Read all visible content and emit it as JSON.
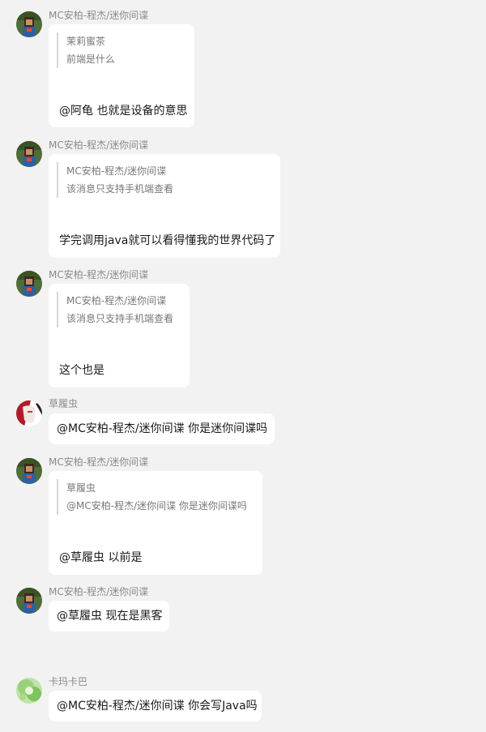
{
  "messages": [
    {
      "sender": "MC安柏-程杰/迷你间谍",
      "avatar": "mc-avatar",
      "quote": {
        "author": "茉莉蜜茶",
        "text": "前端是什么"
      },
      "text": "@阿龟 也就是设备的意思"
    },
    {
      "sender": "MC安柏-程杰/迷你间谍",
      "avatar": "mc-avatar",
      "quote": {
        "author": "MC安柏-程杰/迷你间谍",
        "text": "该消息只支持手机端查看"
      },
      "text": "学完调用java就可以看得懂我的世界代码了"
    },
    {
      "sender": "MC安柏-程杰/迷你间谍",
      "avatar": "mc-avatar",
      "quote": {
        "author": "MC安柏-程杰/迷你间谍",
        "text": "该消息只支持手机端查看"
      },
      "text": "这个也是"
    },
    {
      "sender": "草履虫",
      "avatar": "anime-avatar",
      "text": "@MC安柏-程杰/迷你间谍 你是迷你间谍吗"
    },
    {
      "sender": "MC安柏-程杰/迷你间谍",
      "avatar": "mc-avatar",
      "quote": {
        "author": "草履虫",
        "text": "@MC安柏-程杰/迷你间谍 你是迷你间谍吗"
      },
      "text": "@草履虫 以前是"
    },
    {
      "sender": "MC安柏-程杰/迷你间谍",
      "avatar": "mc-avatar",
      "text": "@草履虫 现在是黑客"
    },
    {
      "sender": "卡玛卡巴",
      "avatar": "green-avatar",
      "text": "@MC安柏-程杰/迷你间谍 你会写Java吗"
    }
  ]
}
